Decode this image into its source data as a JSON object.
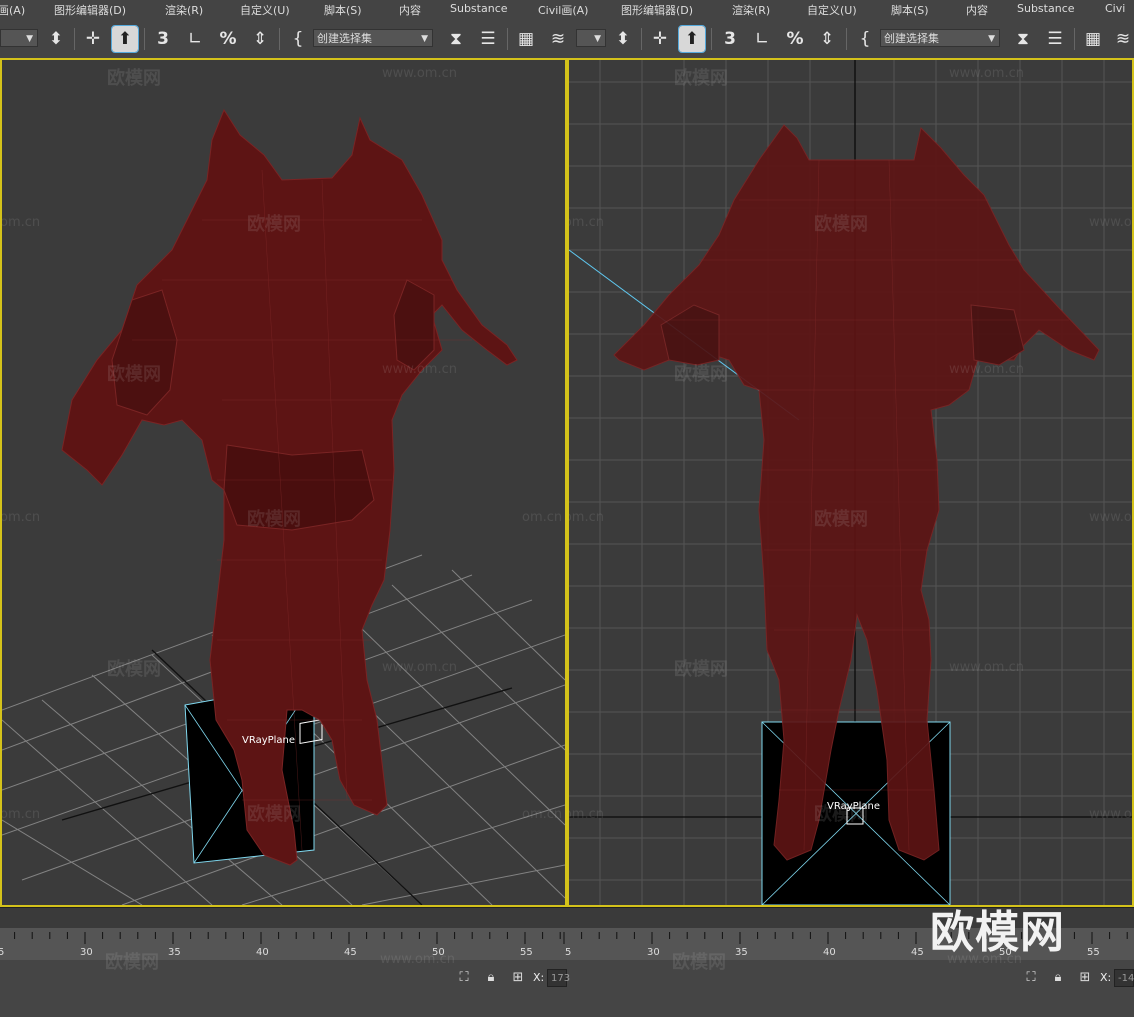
{
  "menubar": {
    "items": [
      {
        "label": "画(A)"
      },
      {
        "label": "图形编辑器(D)"
      },
      {
        "label": "渲染(R)"
      },
      {
        "label": "自定义(U)"
      },
      {
        "label": "脚本(S)"
      },
      {
        "label": "内容"
      },
      {
        "label": "Substance"
      },
      {
        "label": "Civil画(A)"
      },
      {
        "label": "图形编辑器(D)"
      },
      {
        "label": "渲染(R)"
      },
      {
        "label": "自定义(U)"
      },
      {
        "label": "脚本(S)"
      },
      {
        "label": "内容"
      },
      {
        "label": "Substance"
      },
      {
        "label": "Civi"
      }
    ]
  },
  "toolbar": {
    "selection_set_left": "创建选择集",
    "selection_set_right": "创建选择集",
    "dropdown_arrow": "▼",
    "snap_label": "3",
    "percent_label": "%"
  },
  "viewports": {
    "left": {
      "object_label": "VRayPlane"
    },
    "right": {
      "object_label": "VRayPlane"
    },
    "watermark_cn": "欧模网",
    "watermark_url": "www.om.cn",
    "watermark_url_cut": "om.cn",
    "accent_color": "#d4c21a"
  },
  "timeline": {
    "left_ticks": [
      "5",
      "30",
      "35",
      "40",
      "45",
      "50",
      "55"
    ],
    "right_ticks": [
      "5",
      "30",
      "35",
      "40",
      "45",
      "50",
      "55"
    ]
  },
  "statusbar": {
    "x_label_left": "X:",
    "x_value_left": "173",
    "x_label_right": "X:",
    "x_value_right": "-14"
  },
  "brand_watermark": "欧模网"
}
